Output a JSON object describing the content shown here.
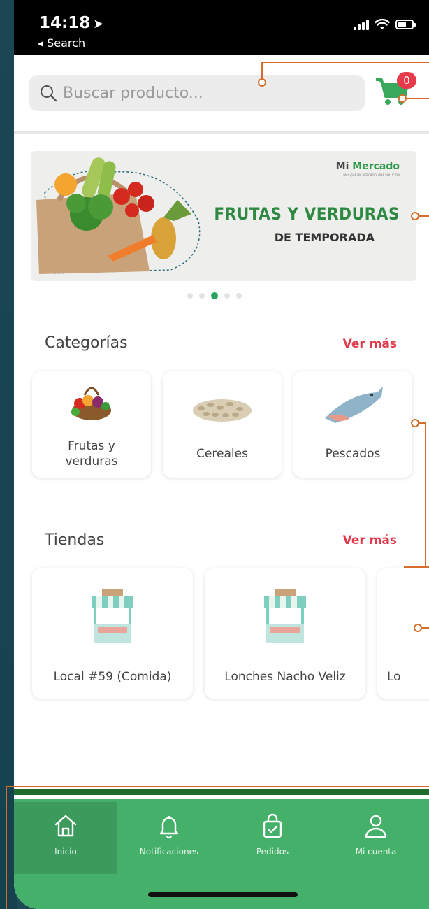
{
  "status_bar": {
    "time": "14:18",
    "back_label": "◂ Search"
  },
  "search": {
    "placeholder": "Buscar producto..."
  },
  "cart": {
    "count": "0"
  },
  "banner": {
    "logo_prefix": "Mi ",
    "logo_brand": "Mercado",
    "logo_tagline": "MÁS QUE UN MERCADO, UNA SOLUCIÓN",
    "title": "FRUTAS Y VERDURAS",
    "subtitle": "DE TEMPORADA",
    "carousel_active_index": 2,
    "carousel_count": 5
  },
  "categories": {
    "title": "Categorías",
    "more": "Ver más",
    "items": [
      {
        "line1": "Frutas y",
        "line2": "verduras"
      },
      {
        "line1": "Cereales",
        "line2": ""
      },
      {
        "line1": "Pescados",
        "line2": ""
      }
    ]
  },
  "stores": {
    "title": "Tiendas",
    "more": "Ver más",
    "items": [
      {
        "name": "Local #59 (Comida)"
      },
      {
        "name": "Lonches Nacho Veliz"
      },
      {
        "name": "Lo"
      }
    ]
  },
  "nav": {
    "items": [
      {
        "label": "Inicio",
        "icon": "home-icon"
      },
      {
        "label": "Notificaciones",
        "icon": "bell-icon"
      },
      {
        "label": "Pedidos",
        "icon": "bag-icon"
      },
      {
        "label": "Mi cuenta",
        "icon": "user-icon"
      }
    ]
  },
  "colors": {
    "accent_green": "#45b06a",
    "nav_active": "#3c9a5c",
    "link_red": "#e23a4c",
    "callout_orange": "#d76d2a"
  }
}
